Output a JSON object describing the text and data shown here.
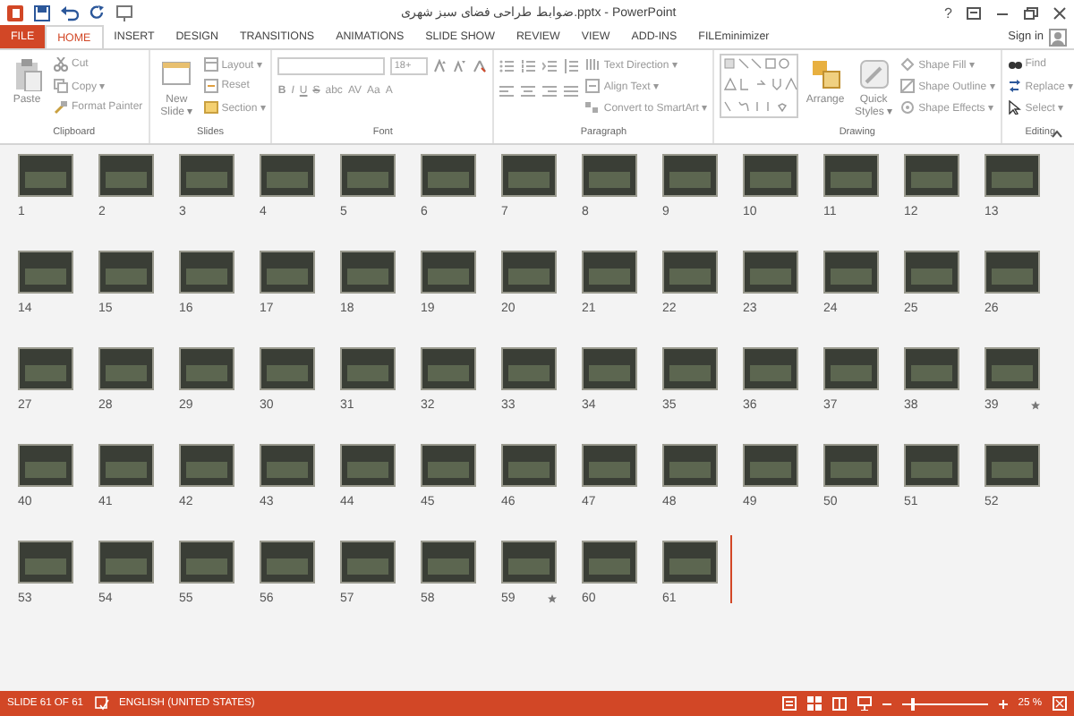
{
  "window": {
    "title": "ضوابط طراحی فضای سبز شهری.pptx - PowerPoint",
    "help": "?"
  },
  "tabs": [
    {
      "label": "FILE",
      "kind": "file",
      "selected": false
    },
    {
      "label": "HOME",
      "kind": "tab",
      "selected": true
    },
    {
      "label": "INSERT",
      "kind": "tab",
      "selected": false
    },
    {
      "label": "DESIGN",
      "kind": "tab",
      "selected": false
    },
    {
      "label": "TRANSITIONS",
      "kind": "tab",
      "selected": false
    },
    {
      "label": "ANIMATIONS",
      "kind": "tab",
      "selected": false
    },
    {
      "label": "SLIDE SHOW",
      "kind": "tab",
      "selected": false
    },
    {
      "label": "REVIEW",
      "kind": "tab",
      "selected": false
    },
    {
      "label": "VIEW",
      "kind": "tab",
      "selected": false
    },
    {
      "label": "ADD-INS",
      "kind": "tab",
      "selected": false
    },
    {
      "label": "FILEminimizer",
      "kind": "tab",
      "selected": false
    }
  ],
  "sign_in": "Sign in",
  "ribbon": {
    "groups": [
      {
        "label": "Clipboard",
        "items": [
          {
            "kind": "large",
            "label": "Paste"
          },
          {
            "kind": "small",
            "label": "Cut"
          },
          {
            "kind": "small",
            "label": "Copy ▾"
          },
          {
            "kind": "small",
            "label": "Format Painter"
          }
        ]
      },
      {
        "label": "Slides",
        "items": [
          {
            "kind": "large",
            "label": "New Slide ▾"
          },
          {
            "kind": "small",
            "label": "Layout ▾"
          },
          {
            "kind": "small",
            "label": "Reset"
          },
          {
            "kind": "small",
            "label": "Section ▾"
          }
        ]
      },
      {
        "label": "Font",
        "items": [
          {
            "kind": "fontbox",
            "label": "18+"
          },
          {
            "kind": "glyphs",
            "glyphs": [
              "B",
              "I",
              "U",
              "S",
              "abc",
              "AV",
              "Aa",
              "A"
            ]
          }
        ]
      },
      {
        "label": "Paragraph",
        "items": [
          {
            "kind": "listicons"
          },
          {
            "kind": "small",
            "label": "Text Direction ▾"
          },
          {
            "kind": "small",
            "label": "Align Text ▾"
          },
          {
            "kind": "small",
            "label": "Convert to SmartArt ▾"
          }
        ]
      },
      {
        "label": "Drawing",
        "items": [
          {
            "kind": "shapes"
          },
          {
            "kind": "large",
            "label": "Arrange"
          },
          {
            "kind": "large",
            "label": "Quick Styles ▾"
          },
          {
            "kind": "small",
            "label": "Shape Fill ▾"
          },
          {
            "kind": "small",
            "label": "Shape Outline ▾"
          },
          {
            "kind": "small",
            "label": "Shape Effects ▾"
          }
        ]
      },
      {
        "label": "Editing",
        "items": [
          {
            "kind": "small",
            "label": "Find"
          },
          {
            "kind": "small",
            "label": "Replace ▾"
          },
          {
            "kind": "small",
            "label": "Select ▾"
          }
        ]
      }
    ]
  },
  "slides": [
    {
      "number": "1",
      "animated": false,
      "cursor_after": false
    },
    {
      "number": "2",
      "animated": false,
      "cursor_after": false
    },
    {
      "number": "3",
      "animated": false,
      "cursor_after": false
    },
    {
      "number": "4",
      "animated": false,
      "cursor_after": false
    },
    {
      "number": "5",
      "animated": false,
      "cursor_after": false
    },
    {
      "number": "6",
      "animated": false,
      "cursor_after": false
    },
    {
      "number": "7",
      "animated": false,
      "cursor_after": false
    },
    {
      "number": "8",
      "animated": false,
      "cursor_after": false
    },
    {
      "number": "9",
      "animated": false,
      "cursor_after": false
    },
    {
      "number": "10",
      "animated": false,
      "cursor_after": false
    },
    {
      "number": "11",
      "animated": false,
      "cursor_after": false
    },
    {
      "number": "12",
      "animated": false,
      "cursor_after": false
    },
    {
      "number": "13",
      "animated": false,
      "cursor_after": false
    },
    {
      "number": "14",
      "animated": false,
      "cursor_after": false
    },
    {
      "number": "15",
      "animated": false,
      "cursor_after": false
    },
    {
      "number": "16",
      "animated": false,
      "cursor_after": false
    },
    {
      "number": "17",
      "animated": false,
      "cursor_after": false
    },
    {
      "number": "18",
      "animated": false,
      "cursor_after": false
    },
    {
      "number": "19",
      "animated": false,
      "cursor_after": false
    },
    {
      "number": "20",
      "animated": false,
      "cursor_after": false
    },
    {
      "number": "21",
      "animated": false,
      "cursor_after": false
    },
    {
      "number": "22",
      "animated": false,
      "cursor_after": false
    },
    {
      "number": "23",
      "animated": false,
      "cursor_after": false
    },
    {
      "number": "24",
      "animated": false,
      "cursor_after": false
    },
    {
      "number": "25",
      "animated": false,
      "cursor_after": false
    },
    {
      "number": "26",
      "animated": false,
      "cursor_after": false
    },
    {
      "number": "27",
      "animated": false,
      "cursor_after": false
    },
    {
      "number": "28",
      "animated": false,
      "cursor_after": false
    },
    {
      "number": "29",
      "animated": false,
      "cursor_after": false
    },
    {
      "number": "30",
      "animated": false,
      "cursor_after": false
    },
    {
      "number": "31",
      "animated": false,
      "cursor_after": false
    },
    {
      "number": "32",
      "animated": false,
      "cursor_after": false
    },
    {
      "number": "33",
      "animated": false,
      "cursor_after": false
    },
    {
      "number": "34",
      "animated": false,
      "cursor_after": false
    },
    {
      "number": "35",
      "animated": false,
      "cursor_after": false
    },
    {
      "number": "36",
      "animated": false,
      "cursor_after": false
    },
    {
      "number": "37",
      "animated": false,
      "cursor_after": false
    },
    {
      "number": "38",
      "animated": false,
      "cursor_after": false
    },
    {
      "number": "39",
      "animated": true,
      "cursor_after": false
    },
    {
      "number": "40",
      "animated": false,
      "cursor_after": false
    },
    {
      "number": "41",
      "animated": false,
      "cursor_after": false
    },
    {
      "number": "42",
      "animated": false,
      "cursor_after": false
    },
    {
      "number": "43",
      "animated": false,
      "cursor_after": false
    },
    {
      "number": "44",
      "animated": false,
      "cursor_after": false
    },
    {
      "number": "45",
      "animated": false,
      "cursor_after": false
    },
    {
      "number": "46",
      "animated": false,
      "cursor_after": false
    },
    {
      "number": "47",
      "animated": false,
      "cursor_after": false
    },
    {
      "number": "48",
      "animated": false,
      "cursor_after": false
    },
    {
      "number": "49",
      "animated": false,
      "cursor_after": false
    },
    {
      "number": "50",
      "animated": false,
      "cursor_after": false
    },
    {
      "number": "51",
      "animated": false,
      "cursor_after": false
    },
    {
      "number": "52",
      "animated": false,
      "cursor_after": false
    },
    {
      "number": "53",
      "animated": false,
      "cursor_after": false
    },
    {
      "number": "54",
      "animated": false,
      "cursor_after": false
    },
    {
      "number": "55",
      "animated": false,
      "cursor_after": false
    },
    {
      "number": "56",
      "animated": false,
      "cursor_after": false
    },
    {
      "number": "57",
      "animated": false,
      "cursor_after": false
    },
    {
      "number": "58",
      "animated": false,
      "cursor_after": false
    },
    {
      "number": "59",
      "animated": true,
      "cursor_after": false
    },
    {
      "number": "60",
      "animated": false,
      "cursor_after": false
    },
    {
      "number": "61",
      "animated": false,
      "cursor_after": true
    }
  ],
  "status_bar": {
    "slide_info": "SLIDE 61 OF 61",
    "language": "ENGLISH (UNITED STATES)",
    "zoom": {
      "level": 0.12,
      "reading": "25 %"
    }
  }
}
